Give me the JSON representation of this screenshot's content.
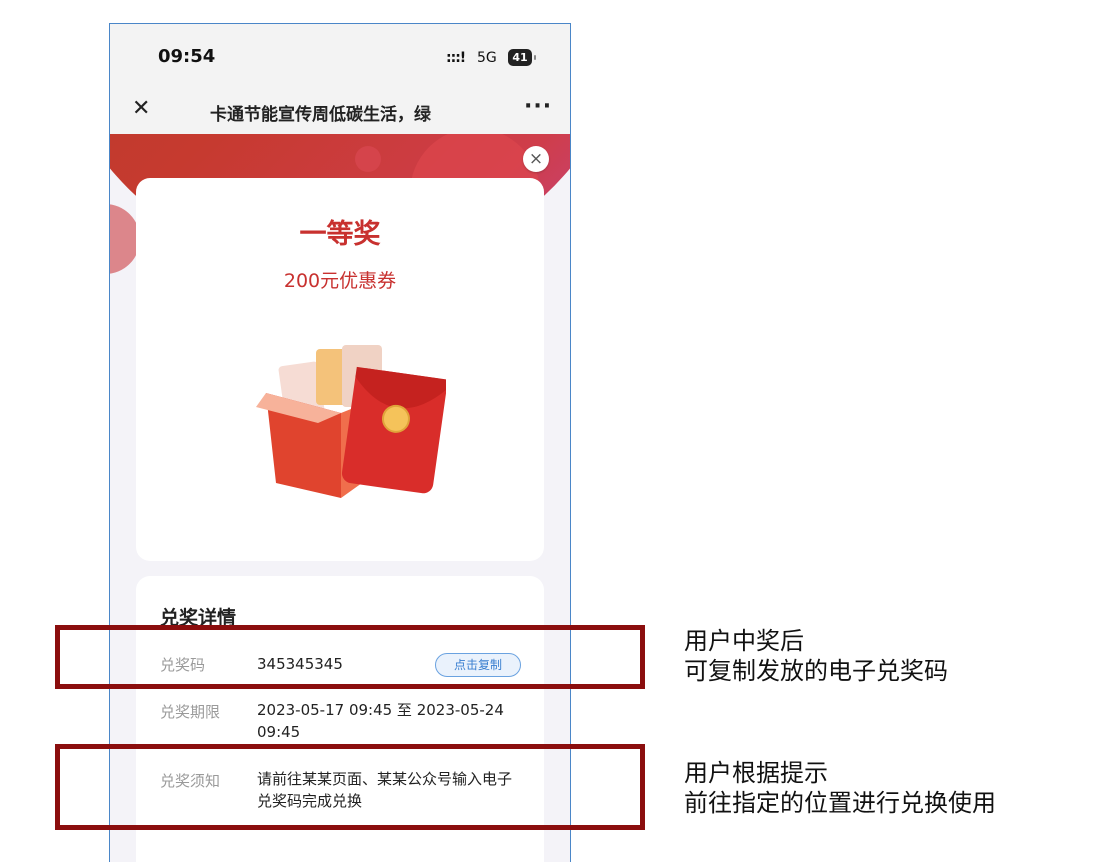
{
  "statusbar": {
    "time": "09:54",
    "signal": ":::!",
    "network": "5G",
    "battery": "41"
  },
  "navbar": {
    "close_icon": "close-icon",
    "title": "卡通节能宣传周低碳生活，绿",
    "more_icon": "more-icon",
    "more_text": "···"
  },
  "popup": {
    "close_symbol": "×",
    "prize_title": "一等奖",
    "prize_subtitle": "200元优惠券",
    "gift_image": "red-envelope-gift-box",
    "detail_heading": "兑奖详情",
    "rows": [
      {
        "label": "兑奖码",
        "value": "345345345",
        "button": "点击复制"
      },
      {
        "label": "兑奖期限",
        "value": "2023-05-17 09:45 至 2023-05-24 09:45"
      },
      {
        "label": "兑奖须知",
        "value": "请前往某某页面、某某公众号输入电子兑奖码完成兑换"
      }
    ]
  },
  "annotations": [
    {
      "line1": "用户中奖后",
      "line2": "可复制发放的电子兑奖码"
    },
    {
      "line1": "用户根据提示",
      "line2": "前往指定的位置进行兑换使用"
    }
  ],
  "colors": {
    "accent": "#c8312f",
    "highlight_border": "#8b0e0e",
    "link": "#3a7fd0"
  }
}
